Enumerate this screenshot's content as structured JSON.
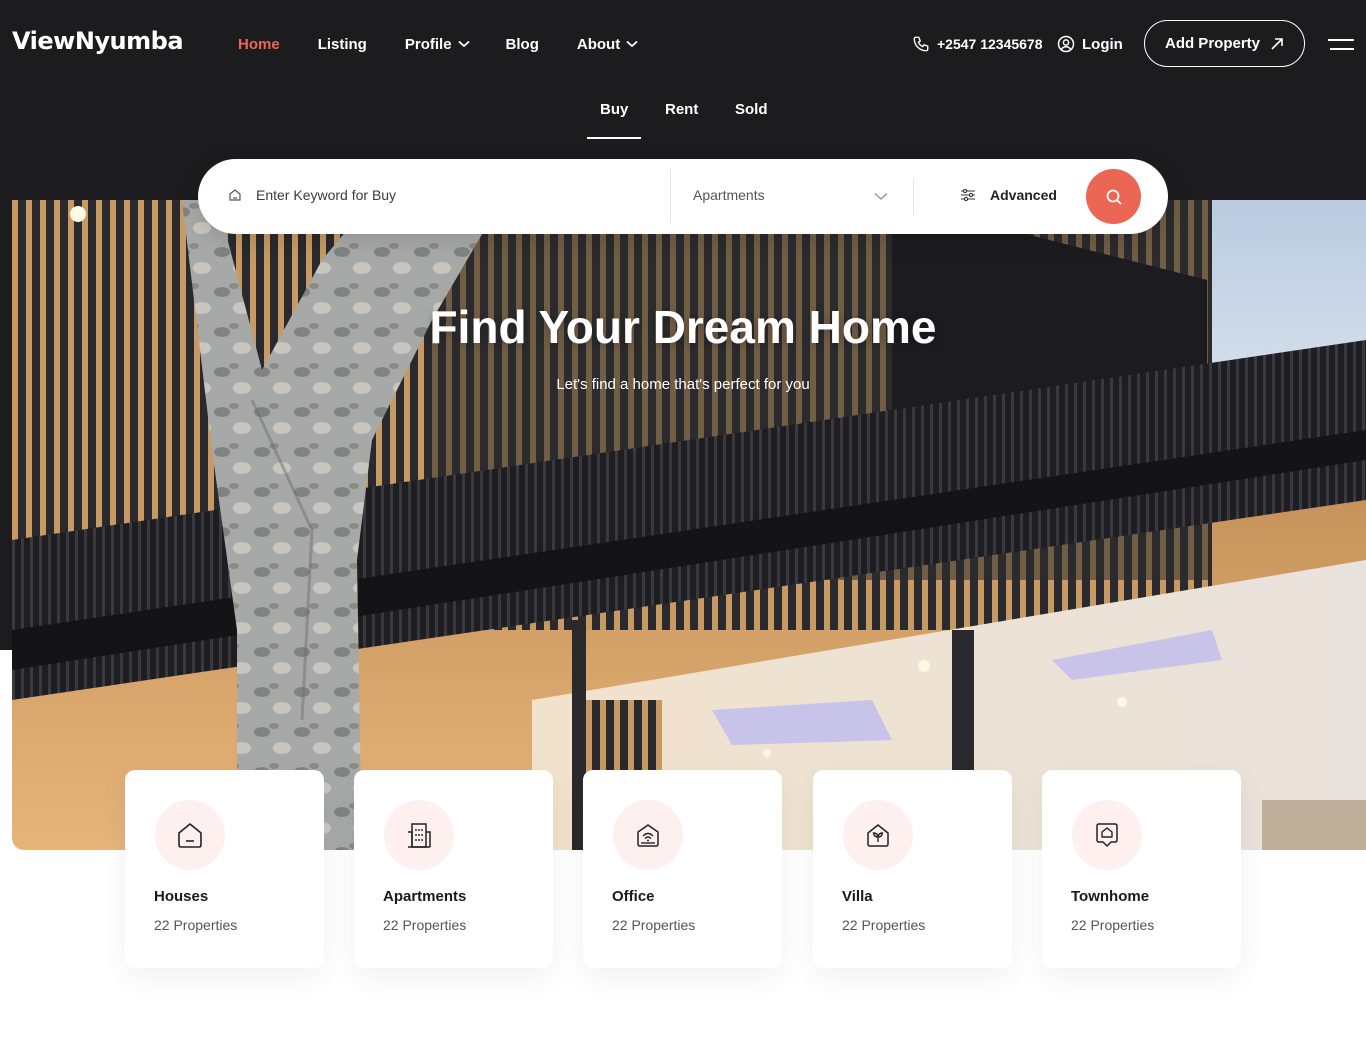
{
  "brand": {
    "name": "ViewNyumba",
    "accent": "#eb6753",
    "dark": "#1c1c1f"
  },
  "nav": {
    "items": [
      {
        "label": "Home",
        "active": true,
        "dropdown": false
      },
      {
        "label": "Listing",
        "active": false,
        "dropdown": false
      },
      {
        "label": "Profile",
        "active": false,
        "dropdown": true
      },
      {
        "label": "Blog",
        "active": false,
        "dropdown": false
      },
      {
        "label": "About",
        "active": false,
        "dropdown": true
      }
    ],
    "phone": "+2547 12345678",
    "login": "Login",
    "add_property": "Add Property"
  },
  "tabs": {
    "items": [
      "Buy",
      "Rent",
      "Sold"
    ],
    "active": "Buy"
  },
  "search": {
    "keyword_placeholder": "Enter Keyword for Buy",
    "property_type": "Apartments",
    "advanced_label": "Advanced"
  },
  "hero": {
    "title": "Find Your Dream Home",
    "subtitle": "Let's find a home that's perfect for you"
  },
  "categories": [
    {
      "title": "Houses",
      "count": "22 Properties",
      "icon": "house-icon"
    },
    {
      "title": "Apartments",
      "count": "22 Properties",
      "icon": "building-icon"
    },
    {
      "title": "Office",
      "count": "22 Properties",
      "icon": "office-icon"
    },
    {
      "title": "Villa",
      "count": "22 Properties",
      "icon": "villa-icon"
    },
    {
      "title": "Townhome",
      "count": "22 Properties",
      "icon": "townhome-icon"
    }
  ]
}
